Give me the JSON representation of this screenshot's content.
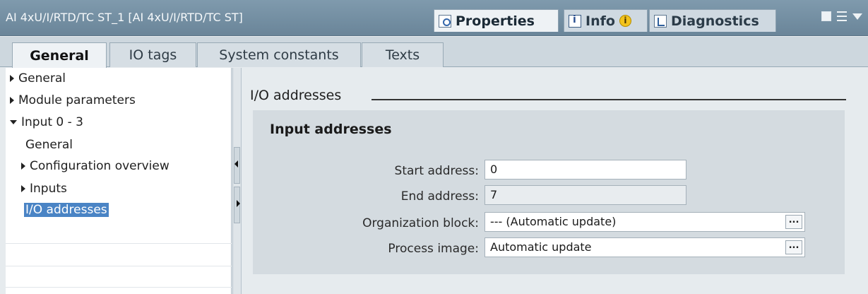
{
  "window": {
    "title": "AI 4xU/I/RTD/TC ST_1 [AI 4xU/I/RTD/TC ST]"
  },
  "panel_tabs": [
    {
      "label": "Properties",
      "icon": "properties-icon"
    },
    {
      "label": "Info",
      "icon": "info-icon",
      "badge": "i"
    },
    {
      "label": "Diagnostics",
      "icon": "diagnostics-icon"
    }
  ],
  "sub_tabs": [
    {
      "label": "General",
      "active": true
    },
    {
      "label": "IO tags"
    },
    {
      "label": "System constants"
    },
    {
      "label": "Texts"
    }
  ],
  "tree": [
    {
      "label": "General",
      "level": 0,
      "expander": "collapsed"
    },
    {
      "label": "Module parameters",
      "level": 0,
      "expander": "collapsed"
    },
    {
      "label": "Input 0 - 3",
      "level": 0,
      "expander": "expanded"
    },
    {
      "label": "General",
      "level": 1,
      "expander": "none"
    },
    {
      "label": "Configuration overview",
      "level": 1,
      "expander": "collapsed"
    },
    {
      "label": "Inputs",
      "level": 1,
      "expander": "collapsed"
    },
    {
      "label": "I/O addresses",
      "level": 1,
      "expander": "none",
      "selected": true
    }
  ],
  "section": {
    "title": "I/O addresses",
    "group_title": "Input addresses",
    "fields": [
      {
        "label": "Start address:",
        "value": "0"
      },
      {
        "label": "End address:",
        "value": "7"
      },
      {
        "label": "Organization block:",
        "value": "--- (Automatic update)"
      },
      {
        "label": "Process image:",
        "value": "Automatic update"
      }
    ],
    "browse_label": "..."
  },
  "colors": {
    "titlebar": "#6a8599",
    "selection": "#4a84c5",
    "warning": "#f3c31b"
  }
}
